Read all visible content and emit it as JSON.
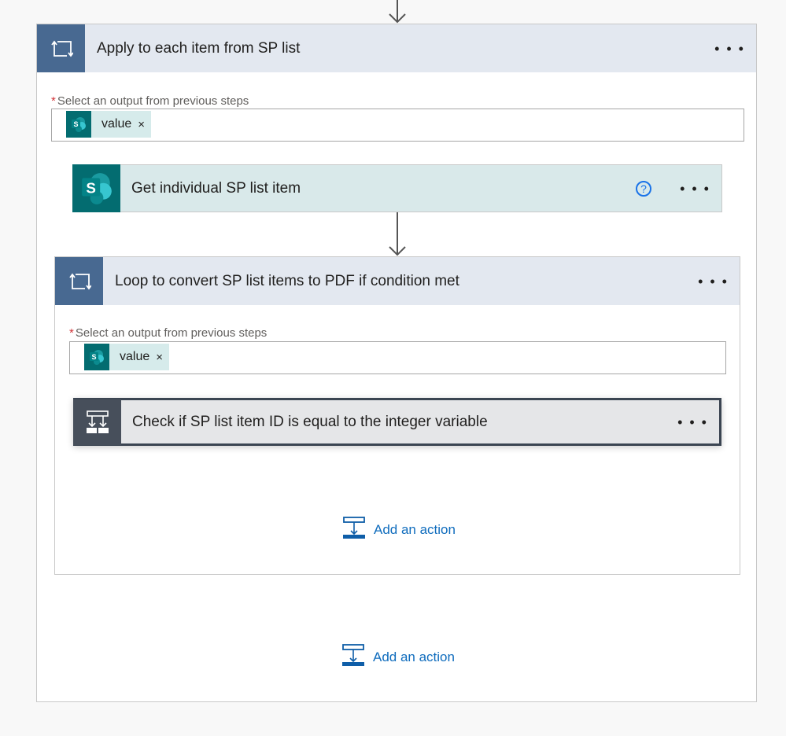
{
  "outer_loop": {
    "icon": "loop-icon",
    "title": "Apply to each item from SP list",
    "more": "• • •",
    "field_label": "Select an output from previous steps",
    "required_mark": "*",
    "token": {
      "icon": "sharepoint-icon",
      "value": "value",
      "remove": "×"
    }
  },
  "get_item": {
    "icon": "sharepoint-icon",
    "title": "Get individual SP list item",
    "help": "?",
    "more": "• • •"
  },
  "inner_loop": {
    "icon": "loop-icon",
    "title": "Loop to convert SP list items to PDF if condition met",
    "more": "• • •",
    "field_label": "Select an output from previous steps",
    "required_mark": "*",
    "token": {
      "icon": "sharepoint-icon",
      "value": "value",
      "remove": "×"
    }
  },
  "condition": {
    "icon": "condition-icon",
    "title": "Check if SP list item ID is equal to the integer variable",
    "more": "• • •"
  },
  "add_action_inner": {
    "label": "Add an action"
  },
  "add_action_outer": {
    "label": "Add an action"
  },
  "colors": {
    "loop_header": "#486991",
    "sharepoint": "#036c70",
    "condition": "#474f5b",
    "link": "#0f6cbd"
  }
}
